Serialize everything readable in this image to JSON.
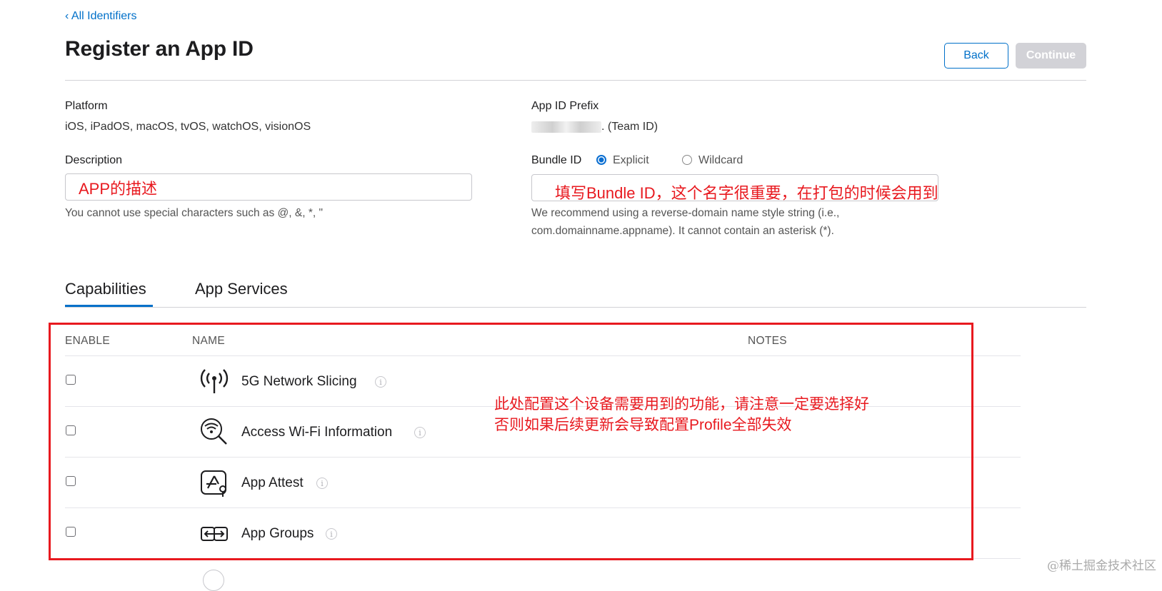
{
  "breadcrumb": "‹ All Identifiers",
  "title": "Register an App ID",
  "buttons": {
    "back": "Back",
    "continue": "Continue"
  },
  "platform": {
    "label": "Platform",
    "value": "iOS, iPadOS, macOS, tvOS, watchOS, visionOS"
  },
  "prefix": {
    "label": "App ID Prefix",
    "suffix": ". (Team ID)"
  },
  "description": {
    "label": "Description",
    "annotation": "APP的描述",
    "help": "You cannot use special characters such as @, &, *, \""
  },
  "bundle": {
    "label": "Bundle ID",
    "options": [
      "Explicit",
      "Wildcard"
    ],
    "selected": "Explicit",
    "annotation": "填写Bundle ID，这个名字很重要，在打包的时候会用到",
    "help_line1": "We recommend using a reverse-domain name style string (i.e.,",
    "help_line2": "com.domainname.appname). It cannot contain an asterisk (*)."
  },
  "tabs": [
    {
      "label": "Capabilities",
      "active": true
    },
    {
      "label": "App Services",
      "active": false
    }
  ],
  "table": {
    "headers": [
      "ENABLE",
      "NAME",
      "NOTES"
    ],
    "rows": [
      {
        "name": "5G Network Slicing",
        "icon": "antenna-icon",
        "checked": false
      },
      {
        "name": "Access Wi-Fi Information",
        "icon": "wifi-search-icon",
        "checked": false
      },
      {
        "name": "App Attest",
        "icon": "app-attest-icon",
        "checked": false
      },
      {
        "name": "App Groups",
        "icon": "app-groups-icon",
        "checked": false
      }
    ]
  },
  "capabilities_annotation": {
    "line1": "此处配置这个设备需要用到的功能，请注意一定要选择好",
    "line2": "否则如果后续更新会导致配置Profile全部失效"
  },
  "watermark": "@稀土掘金技术社区",
  "colors": {
    "link": "#0070c9",
    "annotation": "#e8191f",
    "disabled_button": "#d2d2d7"
  }
}
